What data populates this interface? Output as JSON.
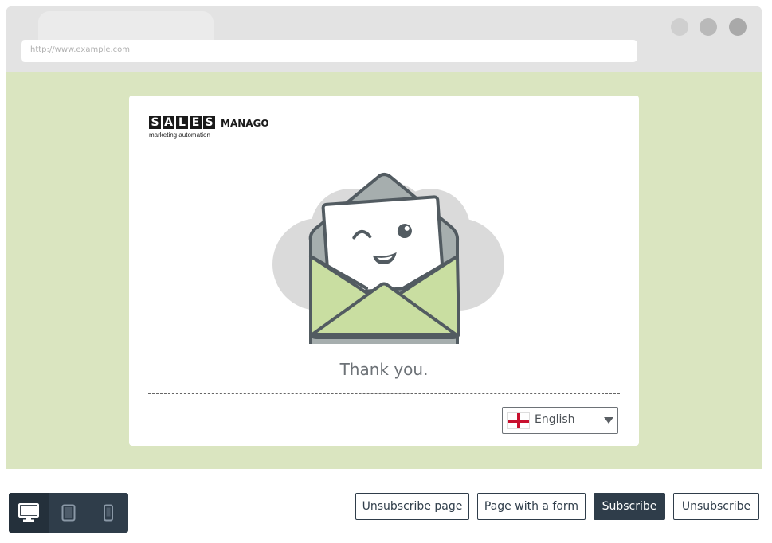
{
  "browser": {
    "url": "http://www.example.com",
    "window_dots": [
      "#cfcfcf",
      "#b9b9b9",
      "#a9a9a9"
    ]
  },
  "logo": {
    "letters": [
      "S",
      "A",
      "L",
      "E",
      "S"
    ],
    "word": "MANAGO",
    "tagline": "marketing automation"
  },
  "page": {
    "message": "Thank you.",
    "language": {
      "selected": "English",
      "flag_icon": "england-flag-icon"
    }
  },
  "toolbar": {
    "devices": [
      "desktop-icon",
      "tablet-icon",
      "mobile-icon"
    ],
    "active_device": "desktop",
    "buttons": {
      "unsubscribe_page": "Unsubscribe page",
      "page_with_form": "Page with a form",
      "subscribe": "Subscribe",
      "unsubscribe": "Unsubscribe"
    }
  },
  "colors": {
    "viewport_bg": "#dae5c0",
    "dark": "#2f3d4a",
    "envelope_green": "#c9dea1"
  }
}
